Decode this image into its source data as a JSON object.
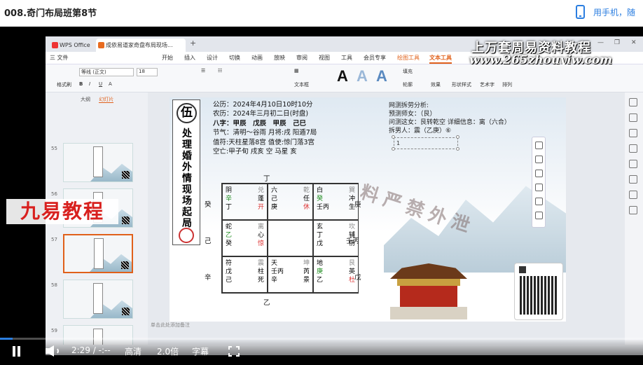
{
  "page": {
    "title": "008.奇门布局班第8节",
    "mobile_link": "用手机，随"
  },
  "app": {
    "tabs": [
      "WPS Office",
      "成依易道家奇盘布局现场..."
    ],
    "menu": [
      "三 文件",
      "开始",
      "插入",
      "设计",
      "切换",
      "动画",
      "放映",
      "审阅",
      "视图",
      "工具",
      "会员专享",
      "绘图工具",
      "文本工具"
    ],
    "ribbon": {
      "format_painter": "格式刷",
      "font_name": "等线 (正文)",
      "font_size": "18",
      "text_box": "文本框",
      "art_text": "艺术字",
      "shape_fill": "填充",
      "outline": "轮廓",
      "effects": "效果",
      "shape": "形状样式",
      "arrange": "排列"
    },
    "watermark_top": "上万套周易资料教程",
    "watermark_url": "www.265zhouyiw.com",
    "left_tabs": {
      "outline": "大纲",
      "slides": "幻灯片"
    },
    "slide_numbers": [
      "55",
      "56",
      "57",
      "58",
      "59"
    ],
    "brand_overlay": "九易教程",
    "notes_placeholder": "单击此处添加备注"
  },
  "slide": {
    "circle_char": "伍",
    "vertical_title": "处理婚外情现场起局",
    "info": [
      "公历：2024年4月10日10时10分",
      "农历：2024年三月初二日(时盘)",
      "八字：甲辰　戊辰　甲辰　己巳",
      "节气：清明～谷雨 月将:戌 阳遁7局",
      "值符:天柱星落8宫 值使:惊门落3宫",
      "空亡:甲子旬 戌亥 空 马星 亥"
    ],
    "analysis": [
      "网测拆劳分析:",
      "预测师女：（艮）",
      "问测这女：艮转乾空 详细信息：离（六合）",
      "拆男人：震（乙庚）⑥"
    ],
    "selected_text": "1",
    "outer": {
      "top": "丁",
      "bottom": "乙",
      "left": [
        "癸",
        "己",
        "辛"
      ],
      "right": [
        "庚",
        "壬丙",
        "戊"
      ]
    },
    "cells": [
      {
        "l1": "阴",
        "r1": "兑",
        "l2": "辛",
        "r2": "蓬",
        "l3": "丁",
        "r3": "开"
      },
      {
        "l1": "六",
        "r1": "乾",
        "l2": "己",
        "r2": "任",
        "l3": "庚",
        "r3": "休"
      },
      {
        "l1": "白",
        "r1": "巽",
        "l2": "癸",
        "r2": "冲",
        "l3": "壬丙",
        "r3": "生"
      },
      {
        "l1": "蛇",
        "r1": "离",
        "l2": "乙",
        "r2": "心",
        "l3": "癸",
        "r3": "惊"
      },
      {
        "l1": "",
        "r1": "",
        "l2": "",
        "r2": "",
        "l3": "",
        "r3": ""
      },
      {
        "l1": "玄",
        "r1": "坎",
        "l2": "丁",
        "r2": "辅",
        "l3": "戊",
        "r3": "伤"
      },
      {
        "l1": "符",
        "r1": "震",
        "l2": "戊",
        "r2": "柱",
        "l3": "己",
        "r3": "死"
      },
      {
        "l1": "天",
        "r1": "坤",
        "l2": "壬丙",
        "r2": "芮",
        "l3": "辛",
        "r3": "景"
      },
      {
        "l1": "地",
        "r1": "艮",
        "l2": "庚",
        "r2": "英",
        "l3": "乙",
        "r3": "杜"
      }
    ],
    "watermark_diag": "料严禁外泄",
    "horse": "马"
  },
  "player": {
    "time": "2:29 / -:--",
    "quality": "高清",
    "speed": "2.0倍",
    "subtitle": "字幕",
    "progress": 0.02
  },
  "colors": {
    "accent": "#e0601a",
    "link": "#2b7ee0",
    "green": "#1a8a1a",
    "red": "#d33333"
  }
}
